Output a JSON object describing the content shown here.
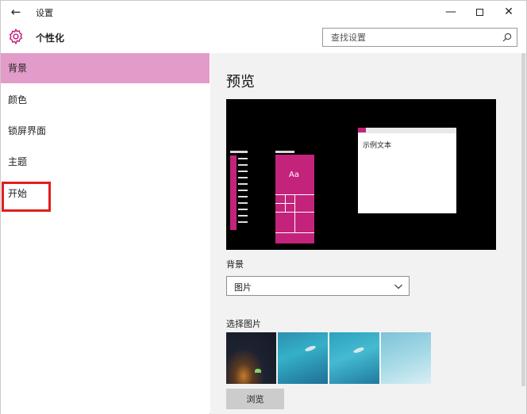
{
  "window": {
    "title": "设置",
    "back_icon": "back-arrow-icon",
    "minimize_glyph": "—",
    "close_glyph": "✕"
  },
  "header": {
    "title": "个性化",
    "icon": "gear-icon",
    "search": {
      "placeholder": "查找设置",
      "value": ""
    }
  },
  "sidebar": {
    "items": [
      {
        "label": "背景",
        "active": true
      },
      {
        "label": "颜色",
        "active": false
      },
      {
        "label": "锁屏界面",
        "active": false
      },
      {
        "label": "主题",
        "active": false
      },
      {
        "label": "开始",
        "active": false,
        "highlighted": true
      }
    ]
  },
  "main": {
    "preview": {
      "title": "预览",
      "tile_label": "Aa",
      "sample_text": "示例文本"
    },
    "background": {
      "label": "背景",
      "selected": "图片"
    },
    "choose_picture": {
      "label": "选择图片",
      "thumbnails": [
        "night-sky-tent",
        "underwater-ray",
        "underwater-ray",
        "underwater-light"
      ]
    },
    "browse_label": "浏览"
  },
  "colors": {
    "accent": "#c3237a",
    "sidebar_active": "#e29cc9",
    "highlight_box": "#e01e1e",
    "main_bg": "#f2f2f2"
  }
}
